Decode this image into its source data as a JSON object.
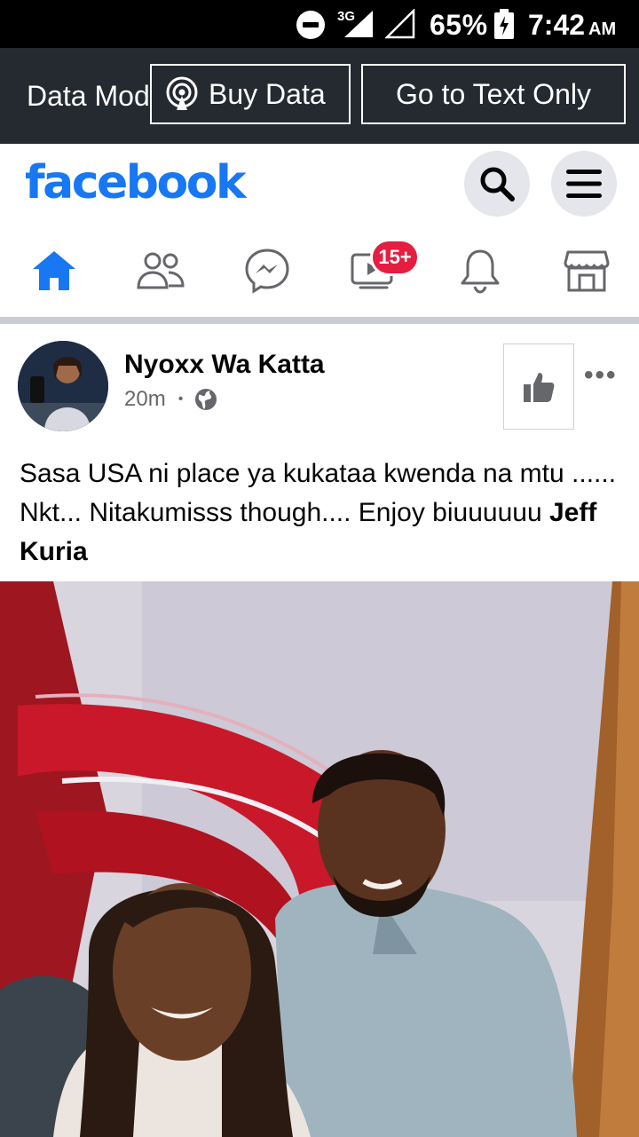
{
  "status_bar": {
    "network": "3G",
    "battery_percent": "65%",
    "time": "7:42",
    "ampm": "AM"
  },
  "data_bar": {
    "label": "Data Mode",
    "buy_data": "Buy Data",
    "text_only": "Go to Text Only"
  },
  "header": {
    "logo": "facebook"
  },
  "nav": {
    "watch_badge": "15+"
  },
  "post": {
    "author": "Nyoxx Wa Katta",
    "time": "20m",
    "text": "Sasa USA ni place ya kukataa kwenda na mtu ...... Nkt... Nitakumisss though.... Enjoy biuuuuuu",
    "tagged": "Jeff Kuria"
  },
  "colors": {
    "brand": "#1877f2",
    "badge": "#e41e3f",
    "data_bar": "#252a31"
  },
  "icons": [
    "dnd-icon",
    "signal-icon",
    "battery-icon",
    "broadcast-icon",
    "search-icon",
    "menu-icon",
    "home-icon",
    "friends-icon",
    "messenger-icon",
    "watch-icon",
    "bell-icon",
    "marketplace-icon",
    "globe-icon",
    "thumbs-up-icon",
    "more-icon"
  ]
}
